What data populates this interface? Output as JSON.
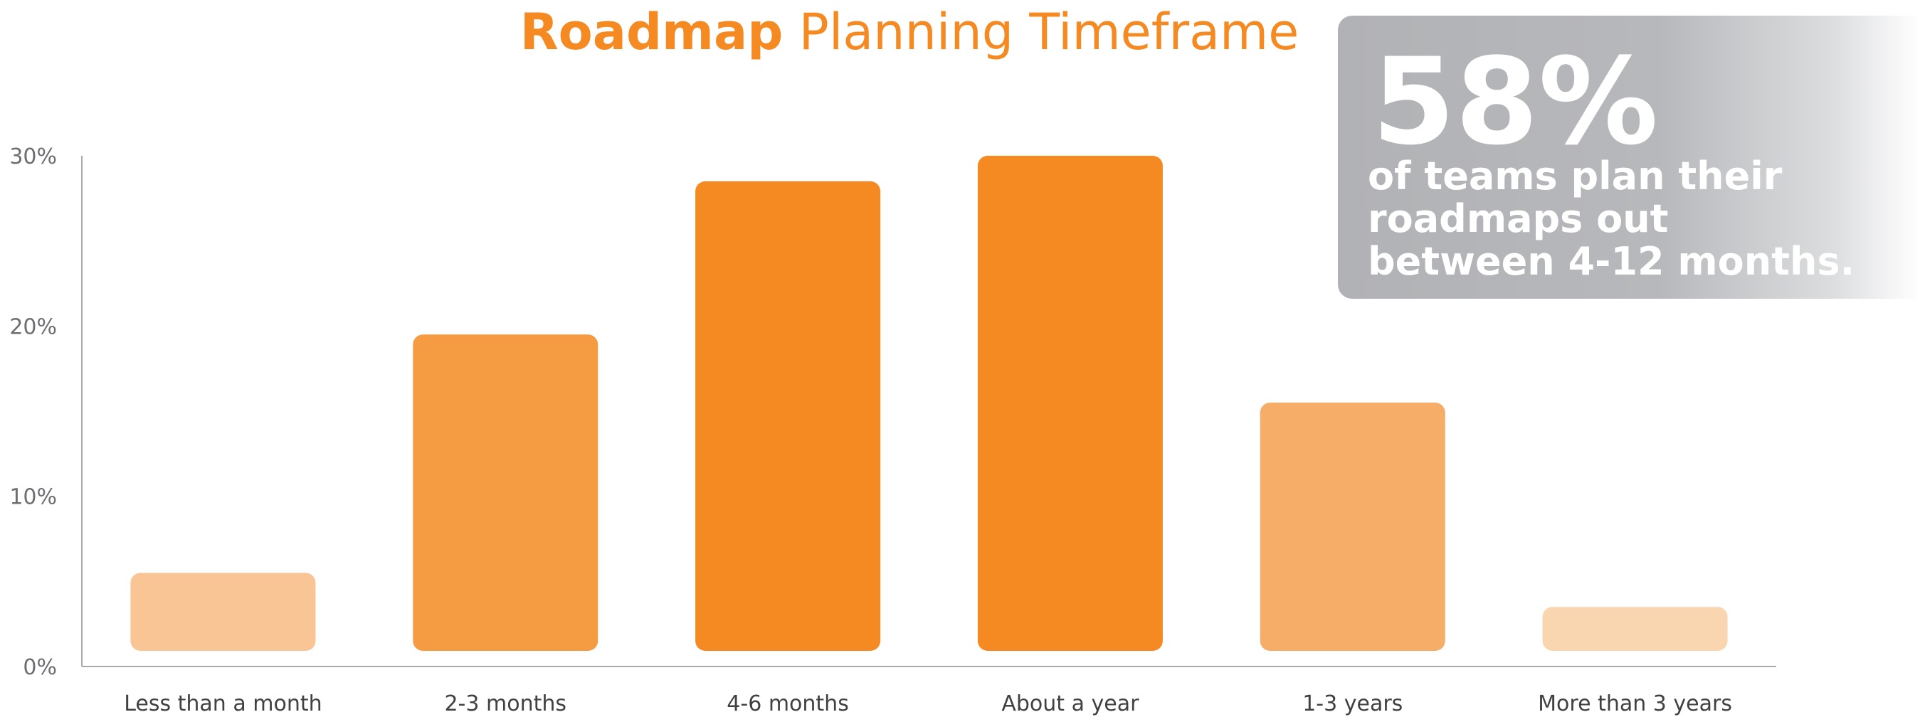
{
  "title": {
    "bold": "Roadmap",
    "light": "Planning Timeframe"
  },
  "callout": {
    "stat": "58%",
    "text": "of teams plan their roadmaps out between 4-12 months."
  },
  "colors": {
    "title": "#f48a21",
    "axis": "#a9a9a9",
    "tick_text": "#6d6e71",
    "category_text": "#414042",
    "callout_bg": "#b1b2b5"
  },
  "chart_data": {
    "type": "bar",
    "categories": [
      "Less than a month",
      "2-3 months",
      "4-6 months",
      "About a year",
      "1-3 years",
      "More than 3 years"
    ],
    "values": [
      5.5,
      19.5,
      28.5,
      30,
      15.5,
      3.5
    ],
    "bar_colors": [
      "#f9c595",
      "#f59b41",
      "#f48a21",
      "#f48a21",
      "#f6ad67",
      "#f9d5b0"
    ],
    "yticks": [
      0,
      10,
      20,
      30
    ],
    "ytick_labels": [
      "0%",
      "10%",
      "20%",
      "30%"
    ],
    "ylim": [
      0,
      30
    ],
    "title": "Roadmap Planning Timeframe",
    "xlabel": "",
    "ylabel": "",
    "grid": false,
    "legend": "none"
  }
}
